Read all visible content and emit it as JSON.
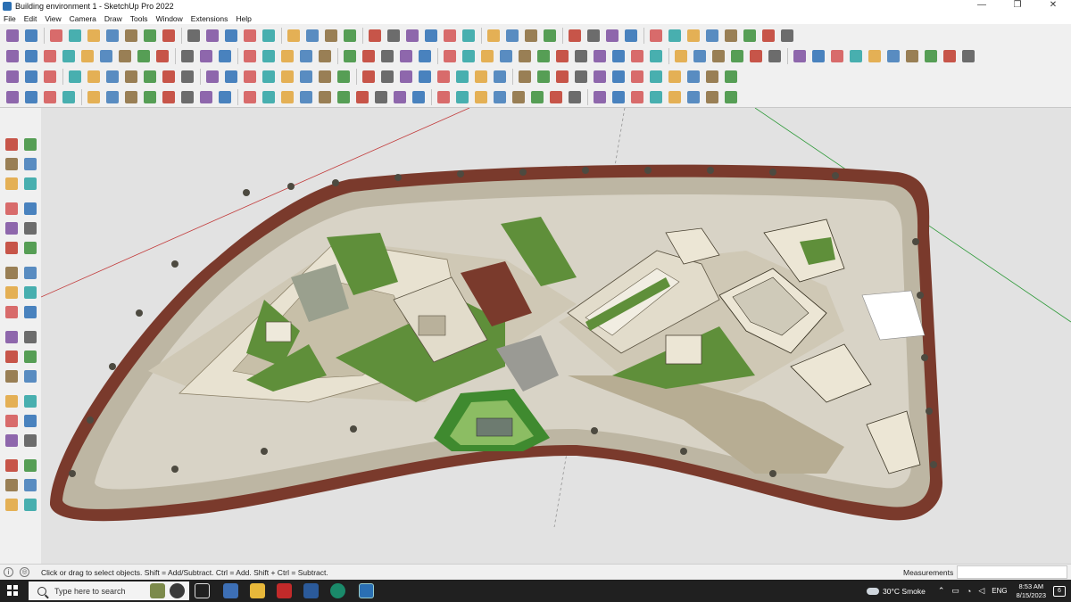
{
  "window": {
    "title": "Building environment 1 - SketchUp Pro 2022",
    "minimize": "—",
    "restore": "❐",
    "close": "✕"
  },
  "menu": [
    "File",
    "Edit",
    "View",
    "Camera",
    "Draw",
    "Tools",
    "Window",
    "Extensions",
    "Help"
  ],
  "status": {
    "hint": "Click or drag to select objects. Shift = Add/Subtract. Ctrl = Add. Shift + Ctrl = Subtract.",
    "measurements_label": "Measurements",
    "measurements_value": ""
  },
  "taskbar": {
    "search_placeholder": "Type here to search",
    "weather": "30°C  Smoke",
    "language": "ENG",
    "time": "8:53 AM",
    "date": "8/15/2023",
    "notifications": "6"
  },
  "colors": {
    "model_ground": "#d8d3c6",
    "road": "#7a3a2c",
    "grass": "#5f8f3a",
    "sidewalk": "#bdb6a3",
    "viewport_bg": "#e2e2e2",
    "red_axis": "#c23a3a",
    "green_axis": "#2f9a3a"
  },
  "icons": {
    "row1": [
      "search-icon",
      "select-icon",
      "eraser-icon",
      "pencil-icon",
      "arc-icon",
      "paint-bucket-icon",
      "move-icon",
      "push-pull-icon",
      "rotate-icon",
      "scale-icon",
      "tape-icon",
      "text-icon",
      "paint-icon",
      "orbit-icon",
      "pan-icon",
      "zoom-icon",
      "zoom-extents-icon",
      "sandbox-icon",
      "layer-icon",
      "component-icon",
      "user-icon"
    ],
    "left": [
      "select-icon",
      "orbit-icon",
      "paint-bucket-icon",
      "eraser-icon",
      "component-icon",
      "pencil-icon",
      "line-icon",
      "freehand-icon",
      "rectangle-icon",
      "rotated-rect-icon",
      "circle-icon",
      "polygon-icon",
      "arc-icon",
      "pie-icon",
      "offset-icon",
      "push-pull-icon",
      "move-icon",
      "follow-me-icon",
      "rotate-icon",
      "scale-icon",
      "tape-icon",
      "text-icon",
      "protractor-icon",
      "axes-icon",
      "section-icon",
      "walk-icon",
      "zoom-icon",
      "zoom-window-icon",
      "zoom-extents-icon",
      "previous-icon",
      "position-camera-icon",
      "look-around-icon",
      "walk-icon",
      "sandbox-icon",
      "layer-icon"
    ]
  }
}
